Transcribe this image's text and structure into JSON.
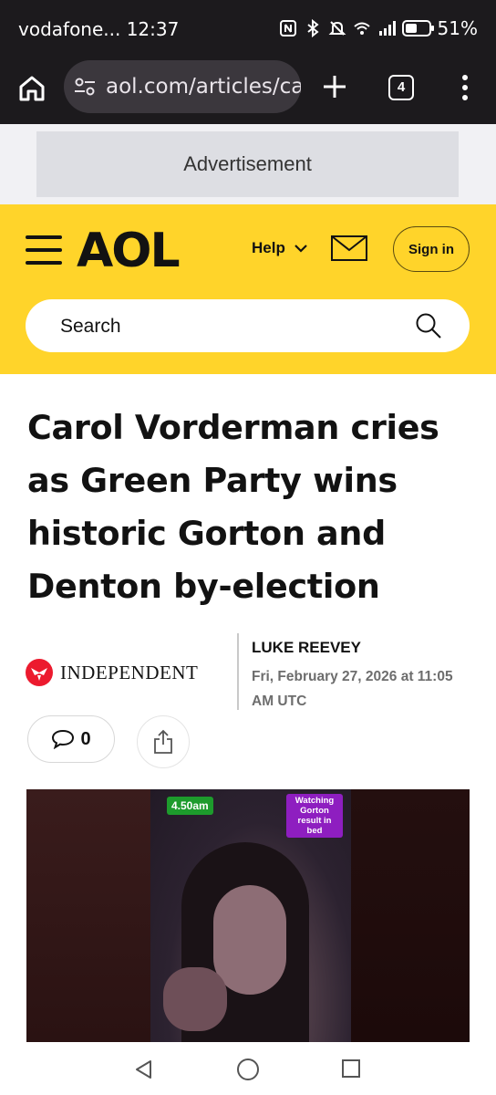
{
  "status_bar": {
    "carrier_time": "vodafone... 12:37",
    "battery": "51%",
    "battery_level": 0.51
  },
  "browser": {
    "url": "aol.com/articles/carol-vorderman",
    "tab_count": "4"
  },
  "ad": {
    "label": "Advertisement"
  },
  "header": {
    "logo": "AOL",
    "help_label": "Help",
    "sign_in_label": "Sign in",
    "search_placeholder": "Search",
    "brand_color": "#ffd42a"
  },
  "article": {
    "headline": "Carol Vorderman cries as Green Party wins historic Gorton and Denton by-election",
    "publisher": "INDEPENDENT",
    "author": "LUKE REEVEY",
    "date": "Fri, February 27, 2026 at 11:05 AM UTC",
    "comment_count": "0"
  },
  "video": {
    "time_tag": "4.50am",
    "caption_tag": "Watching Gorton result in bed"
  },
  "icons": [
    "home-icon",
    "site-settings-icon",
    "plus-icon",
    "more-vert-icon",
    "hamburger-icon",
    "chevron-down-icon",
    "mail-icon",
    "search-icon",
    "comment-icon",
    "share-icon",
    "back-icon",
    "home-nav-icon",
    "recents-icon"
  ]
}
